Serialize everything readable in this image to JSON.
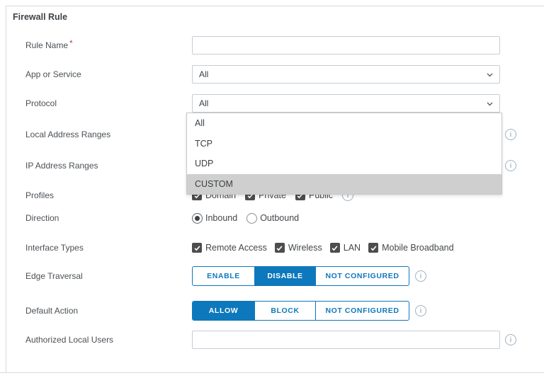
{
  "panel": {
    "title": "Firewall Rule"
  },
  "colors": {
    "accent_blue": "#0e78bd",
    "required_red": "#c0453c",
    "dropdown_highlight": "#cfcfcf",
    "checkbox_fill": "#4d4d4d"
  },
  "fields": {
    "rule_name": {
      "label": "Rule Name",
      "required_marker": "*",
      "value": ""
    },
    "app_or_service": {
      "label": "App or Service",
      "selected": "All"
    },
    "protocol": {
      "label": "Protocol",
      "selected": "All"
    },
    "local_address_ranges": {
      "label": "Local Address Ranges",
      "value": ""
    },
    "ip_address_ranges": {
      "label": "IP Address Ranges",
      "value": ""
    },
    "profiles": {
      "label": "Profiles",
      "options": [
        {
          "label": "Domain",
          "checked": true
        },
        {
          "label": "Private",
          "checked": true
        },
        {
          "label": "Public",
          "checked": true
        }
      ]
    },
    "direction": {
      "label": "Direction",
      "options": [
        {
          "label": "Inbound",
          "selected": true
        },
        {
          "label": "Outbound",
          "selected": false
        }
      ]
    },
    "interface_types": {
      "label": "Interface Types",
      "options": [
        {
          "label": "Remote Access",
          "checked": true
        },
        {
          "label": "Wireless",
          "checked": true
        },
        {
          "label": "LAN",
          "checked": true
        },
        {
          "label": "Mobile Broadband",
          "checked": true
        }
      ]
    },
    "edge_traversal": {
      "label": "Edge Traversal",
      "options": [
        {
          "label": "ENABLE",
          "selected": false
        },
        {
          "label": "DISABLE",
          "selected": true
        },
        {
          "label": "NOT CONFIGURED",
          "selected": false
        }
      ]
    },
    "default_action": {
      "label": "Default Action",
      "options": [
        {
          "label": "ALLOW",
          "selected": true
        },
        {
          "label": "BLOCK",
          "selected": false
        },
        {
          "label": "NOT CONFIGURED",
          "selected": false
        }
      ]
    },
    "authorized_local_users": {
      "label": "Authorized Local Users",
      "value": ""
    }
  },
  "protocol_dropdown": {
    "options": [
      {
        "label": "All",
        "highlighted": false
      },
      {
        "label": "TCP",
        "highlighted": false
      },
      {
        "label": "UDP",
        "highlighted": false
      },
      {
        "label": "CUSTOM",
        "highlighted": true
      }
    ]
  },
  "icons": {
    "info": "i"
  }
}
